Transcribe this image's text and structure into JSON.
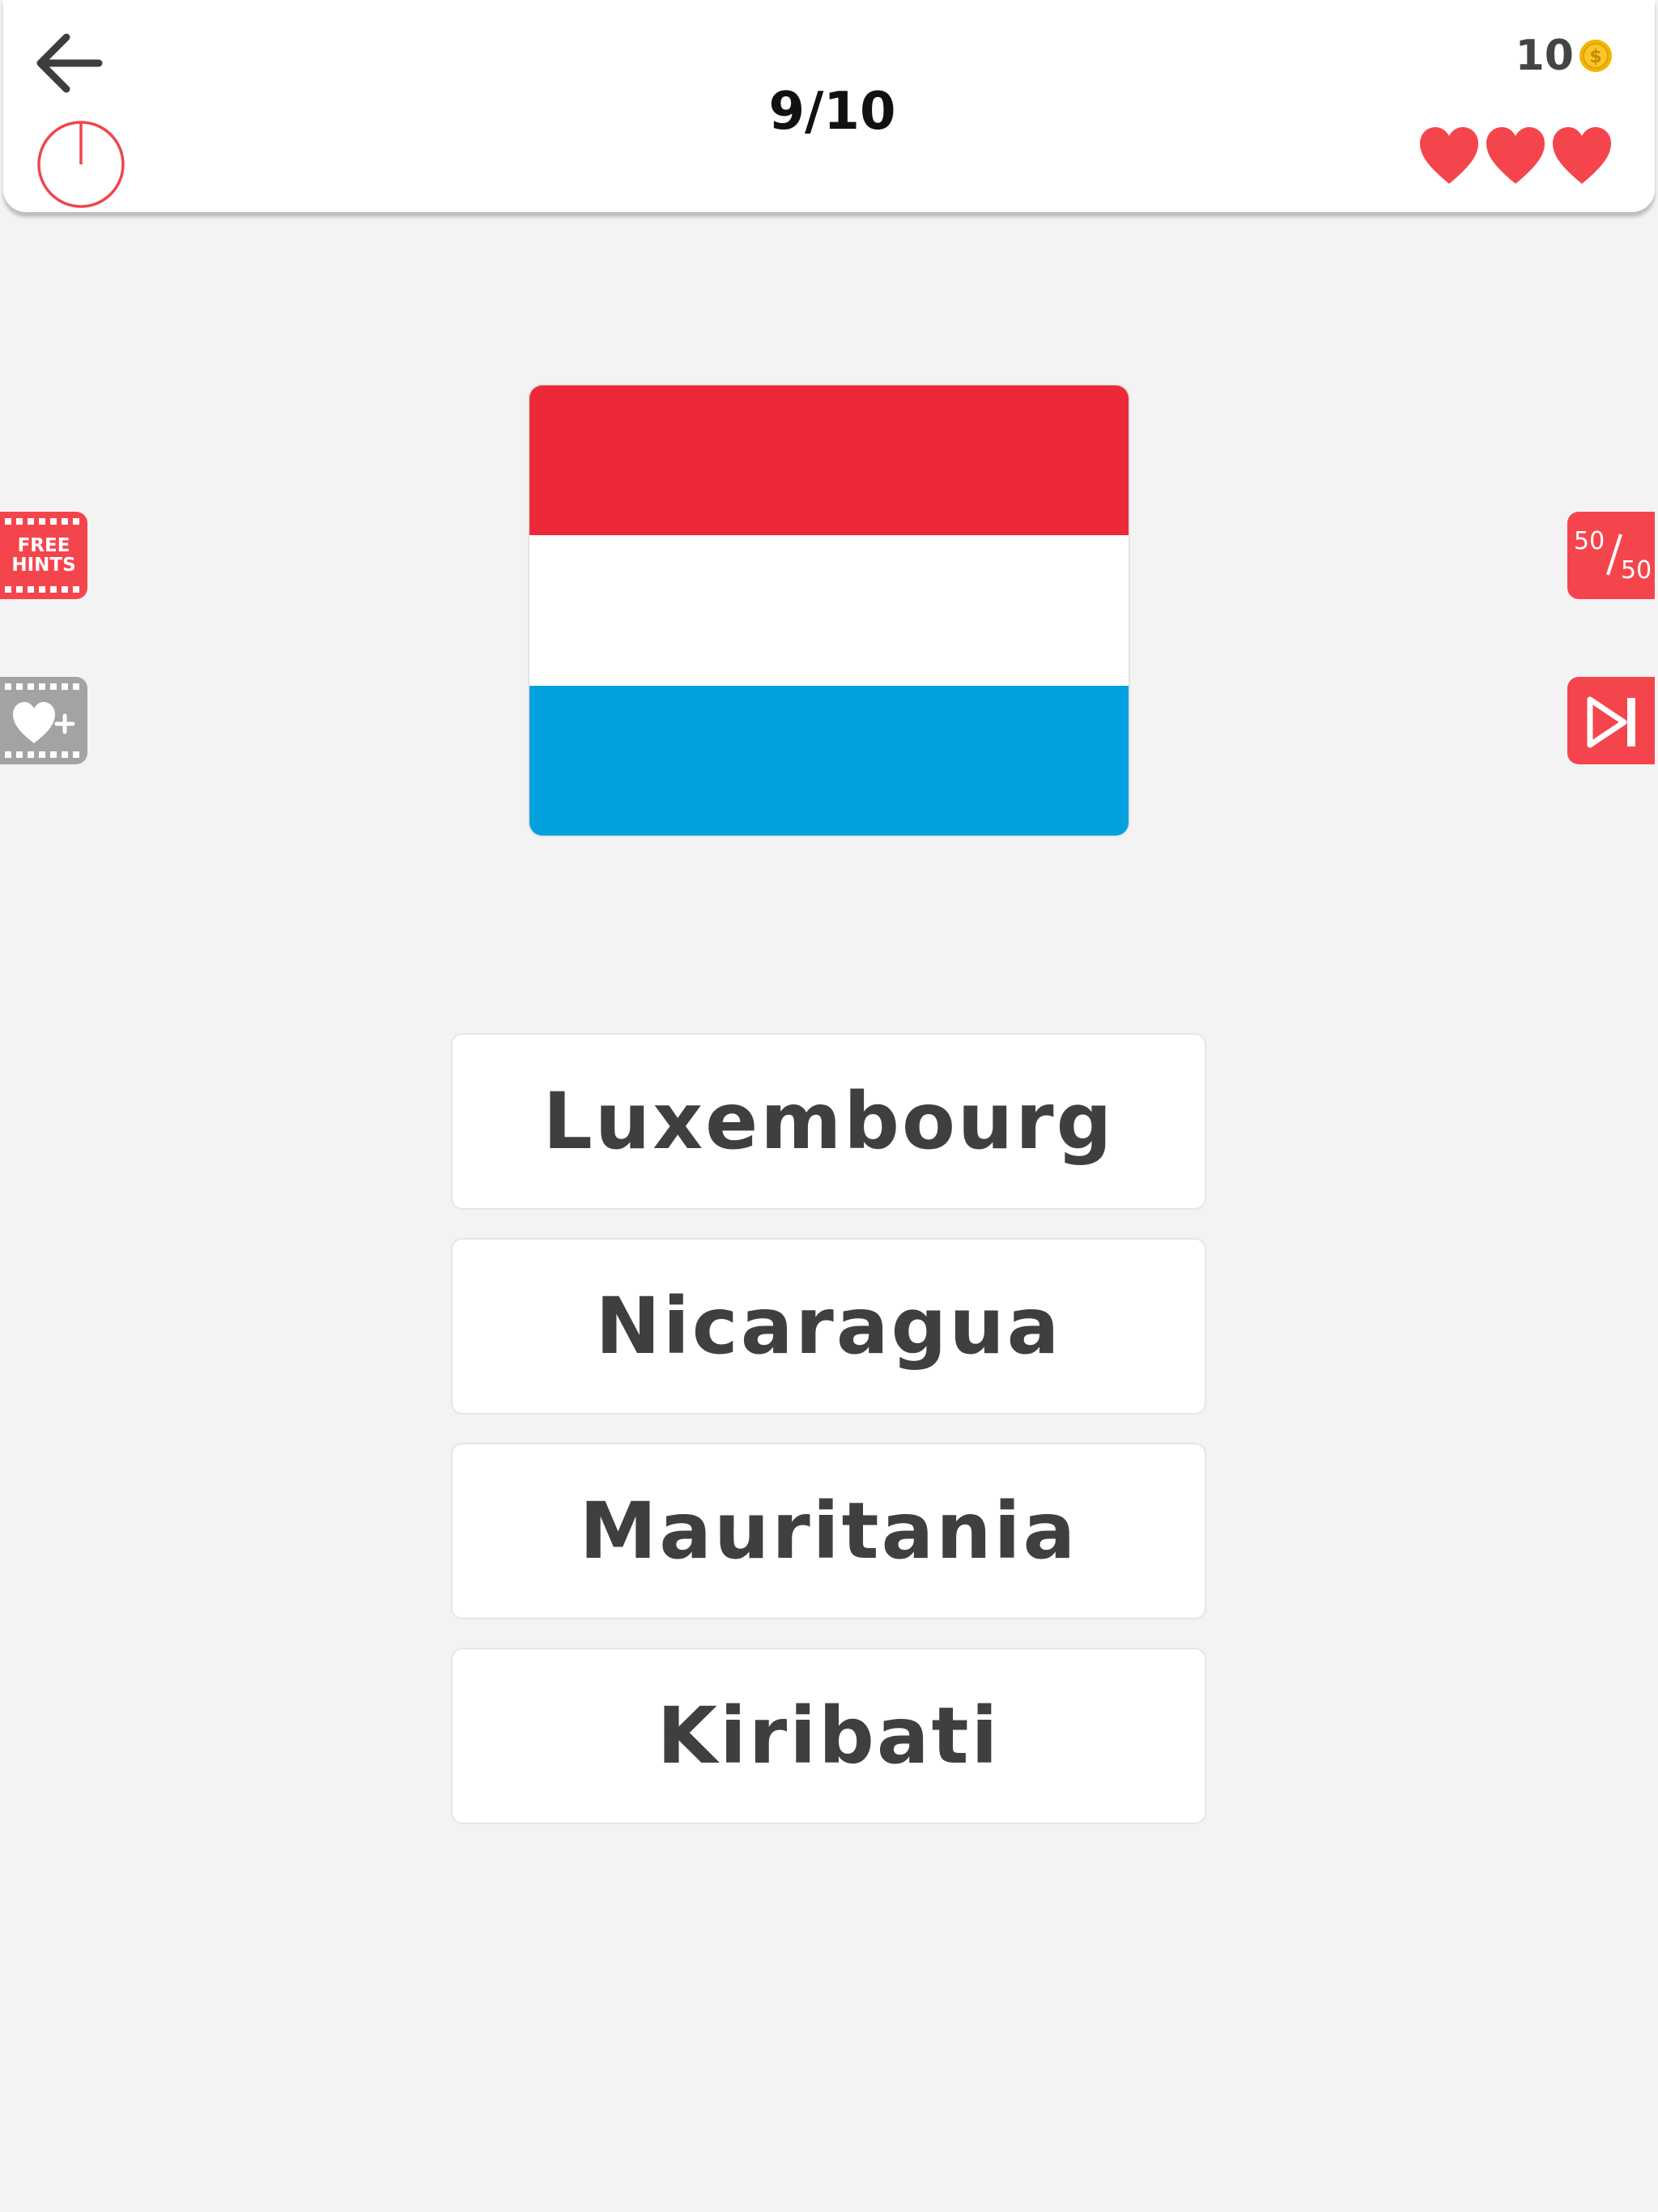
{
  "header": {
    "progress": "9/10",
    "coins": "10",
    "coin_symbol": "$",
    "lives": 3
  },
  "hints": {
    "free_hints_line1": "FREE",
    "free_hints_line2": "HINTS",
    "fifty_top": "50",
    "fifty_bottom": "50"
  },
  "flag": {
    "stripes": [
      "#ed2939",
      "#ffffff",
      "#00a1de"
    ]
  },
  "answers": [
    "Luxembourg",
    "Nicaragua",
    "Mauritania",
    "Kiribati"
  ],
  "colors": {
    "accent": "#f5454c",
    "heart": "#f5454c",
    "coin": "#f5b400",
    "background": "#f3f3f3"
  }
}
